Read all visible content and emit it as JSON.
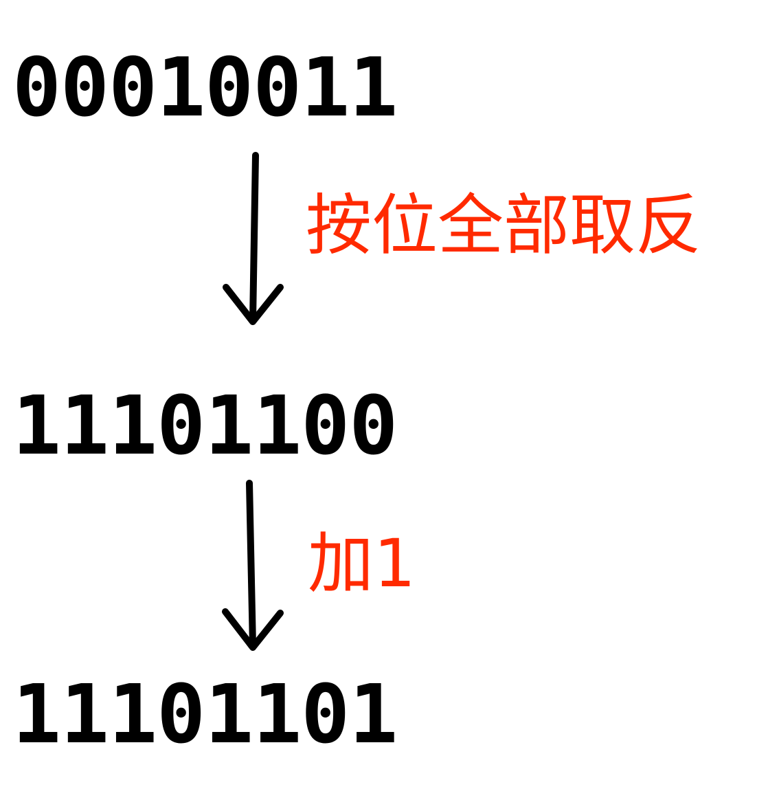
{
  "rows": {
    "original": "00010011",
    "inverted": "11101100",
    "result": "11101101"
  },
  "steps": {
    "invert_label": "按位全部取反",
    "add_one_label": "加1"
  },
  "colors": {
    "digits": "#000000",
    "step_label": "#ff2a00",
    "arrow": "#000000"
  },
  "icons": {
    "arrow": "down-arrow-icon"
  }
}
